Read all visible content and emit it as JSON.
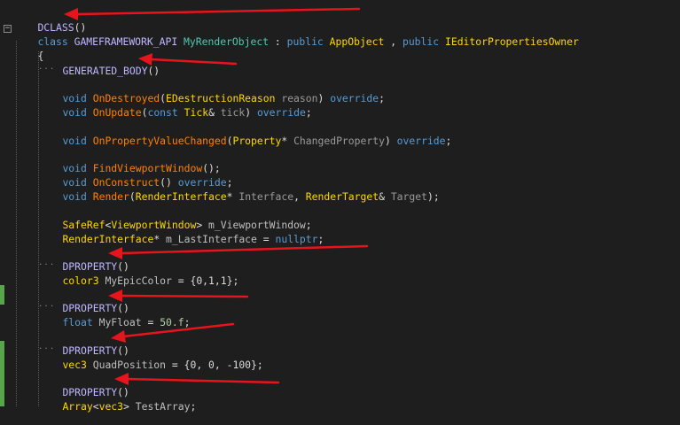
{
  "code": {
    "l1": {
      "macro": "DCLASS",
      "parens": "()"
    },
    "l2": {
      "kw": "class",
      "api": "GAMEFRAMEWORK_API",
      "name": "MyRenderObject",
      "colon": ":",
      "pub1": "public",
      "base1": "AppObject",
      "comma": ",",
      "pub2": "public",
      "base2": "IEditorPropertiesOwner"
    },
    "l3": {
      "brace": "{"
    },
    "l4": {
      "macro": "GENERATED_BODY",
      "parens": "()"
    },
    "l5": {
      "kw": "void",
      "fn": "OnDestroyed",
      "open": "(",
      "type": "EDestructionReason",
      "param": "reason",
      "close": ")",
      "ovr": "override",
      "semi": ";"
    },
    "l6": {
      "kw": "void",
      "fn": "OnUpdate",
      "open": "(",
      "const": "const",
      "type": "Tick",
      "amp": "&",
      "param": "tick",
      "close": ")",
      "ovr": "override",
      "semi": ";"
    },
    "l7": {
      "kw": "void",
      "fn": "OnPropertyValueChanged",
      "open": "(",
      "type": "Property",
      "star": "*",
      "param": "ChangedProperty",
      "close": ")",
      "ovr": "override",
      "semi": ";"
    },
    "l8": {
      "kw": "void",
      "fn": "FindViewportWindow",
      "rest": "();"
    },
    "l9": {
      "kw": "void",
      "fn": "OnConstruct",
      "rest": "()",
      "ovr": "override",
      "semi": ";"
    },
    "l10": {
      "kw": "void",
      "fn": "Render",
      "open": "(",
      "type1": "RenderInterface",
      "star": "*",
      "param1": "Interface",
      "comma": ",",
      "type2": "RenderTarget",
      "amp": "&",
      "param2": "Target",
      "close": ");"
    },
    "l11": {
      "type": "SafeRef",
      "lt": "<",
      "arg": "ViewportWindow",
      "gt": ">",
      "member": "m_ViewportWindow",
      "semi": ";"
    },
    "l12": {
      "type": "RenderInterface",
      "star": "*",
      "member": "m_LastInterface",
      "eq": "=",
      "val": "nullptr",
      "semi": ";"
    },
    "l13": {
      "macro": "DPROPERTY",
      "parens": "()"
    },
    "l14": {
      "type": "color3",
      "member": "MyEpicColor",
      "eq": "=",
      "val": "{0,1,1};"
    },
    "l15": {
      "macro": "DPROPERTY",
      "parens": "()"
    },
    "l16": {
      "kw": "float",
      "member": "MyFloat",
      "eq": "=",
      "val": "50.f",
      "semi": ";"
    },
    "l17": {
      "macro": "DPROPERTY",
      "parens": "()"
    },
    "l18": {
      "type": "vec3",
      "member": "QuadPosition",
      "eq": "=",
      "val": "{0, 0, -100};"
    },
    "l19": {
      "macro": "DPROPERTY",
      "parens": "()"
    },
    "l20": {
      "type": "Array",
      "lt": "<",
      "arg": "vec3",
      "gt": ">",
      "member": "TestArray",
      "semi": ";"
    }
  },
  "fold_glyph": "−",
  "ellipsis": "...",
  "colors": {
    "background": "#1e1e1e",
    "macro": "#beb7ff",
    "keyword": "#569cd6",
    "type": "#4ec9b0",
    "function": "#ff8000",
    "param": "#9a9a9a",
    "number": "#b5cea8",
    "arrow": "#e8141c",
    "change_bar": "#57a64a"
  }
}
